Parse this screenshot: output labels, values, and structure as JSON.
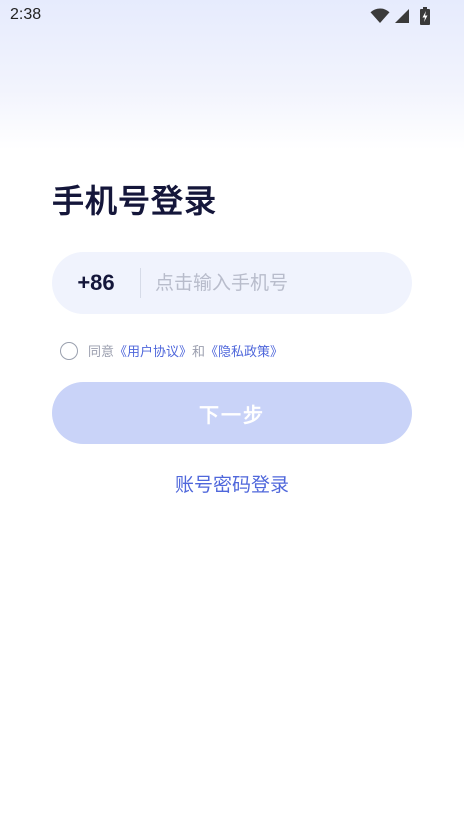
{
  "status_bar": {
    "time": "2:38"
  },
  "login": {
    "title": "手机号登录",
    "country_code": "+86",
    "phone_placeholder": "点击输入手机号",
    "phone_value": "",
    "agreement": {
      "prefix": "同意",
      "user_agreement": "《用户协议》",
      "conjunction": "和",
      "privacy_policy": "《隐私政策》",
      "checked": false
    },
    "next_label": "下一步",
    "alt_login_label": "账号密码登录"
  },
  "colors": {
    "title": "#14163a",
    "link": "#4f67db",
    "button_disabled": "#c9d3f8",
    "input_bg": "#f0f3fd",
    "placeholder": "#b8bccb"
  },
  "icons": [
    "wifi-icon",
    "cell-signal-icon",
    "battery-charging-icon"
  ]
}
